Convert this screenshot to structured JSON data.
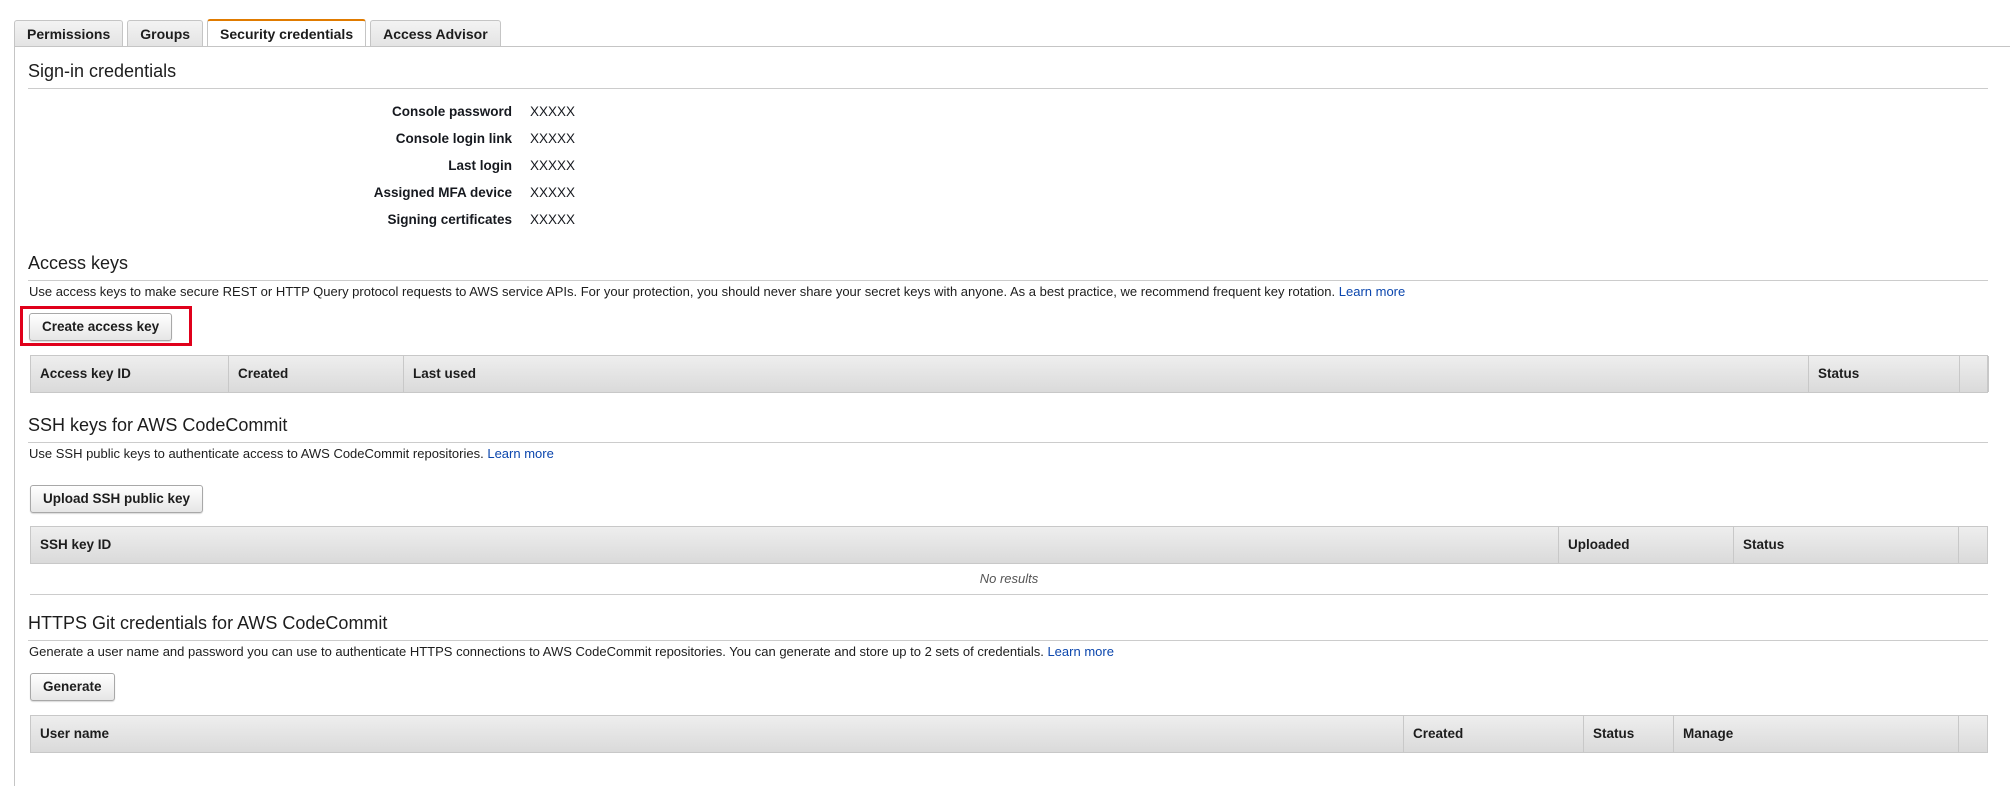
{
  "tabs": [
    {
      "label": "Permissions"
    },
    {
      "label": "Groups"
    },
    {
      "label": "Security credentials"
    },
    {
      "label": "Access Advisor"
    }
  ],
  "signin": {
    "title": "Sign-in credentials",
    "rows": [
      {
        "label": "Console password",
        "value": "XXXXX"
      },
      {
        "label": "Console login link",
        "value": "XXXXX"
      },
      {
        "label": "Last login",
        "value": "XXXXX"
      },
      {
        "label": "Assigned MFA device",
        "value": "XXXXX"
      },
      {
        "label": "Signing certificates",
        "value": "XXXXX"
      }
    ]
  },
  "access_keys": {
    "title": "Access keys",
    "description": "Use access keys to make secure REST or HTTP Query protocol requests to AWS service APIs. For your protection, you should never share your secret keys with anyone. As a best practice, we recommend frequent key rotation.",
    "learn_more": "Learn more",
    "button": "Create access key",
    "columns": [
      "Access key ID",
      "Created",
      "Last used",
      "Status"
    ]
  },
  "ssh_keys": {
    "title": "SSH keys for AWS CodeCommit",
    "description": "Use SSH public keys to authenticate access to AWS CodeCommit repositories.",
    "learn_more": "Learn more",
    "button": "Upload SSH public key",
    "columns": [
      "SSH key ID",
      "Uploaded",
      "Status"
    ],
    "empty": "No results"
  },
  "https_git": {
    "title": "HTTPS Git credentials for AWS CodeCommit",
    "description": "Generate a user name and password you can use to authenticate HTTPS connections to AWS CodeCommit repositories. You can generate and store up to 2 sets of credentials.",
    "learn_more": "Learn more",
    "button": "Generate",
    "columns": [
      "User name",
      "Created",
      "Status",
      "Manage"
    ]
  }
}
